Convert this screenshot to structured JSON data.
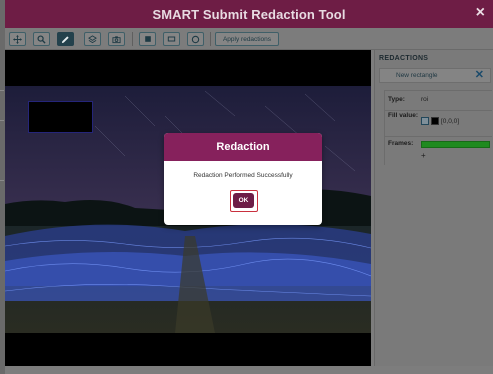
{
  "window": {
    "title": "SMART Submit Redaction Tool",
    "close_glyph": "×"
  },
  "toolbar": {
    "tools": [
      {
        "icon": "move-icon"
      },
      {
        "icon": "zoom-icon"
      },
      {
        "icon": "pencil-icon",
        "active": true
      },
      {
        "icon": "layers-icon"
      },
      {
        "icon": "camera-icon"
      },
      {
        "icon": "filled-square-icon"
      },
      {
        "icon": "rectangle-icon"
      },
      {
        "icon": "circle-icon"
      }
    ],
    "apply_label": "Apply redactions"
  },
  "panel": {
    "title": "REDACTIONS",
    "tab_label": "New rectangle",
    "tab_close": "✕",
    "type_label": "Type:",
    "type_value": "roi",
    "fill_label": "Fill value:",
    "fill_value": "[0,0,0]",
    "frames_label": "Frames:",
    "add_glyph": "+"
  },
  "dialog": {
    "title": "Redaction",
    "message": "Redaction Performed Successfully",
    "ok_label": "OK"
  },
  "colors": {
    "titlebar": "#6e1d45",
    "dialog_header": "#86215c",
    "ok_button": "#6d1d47",
    "frames_bar": "#1f8a1f"
  }
}
